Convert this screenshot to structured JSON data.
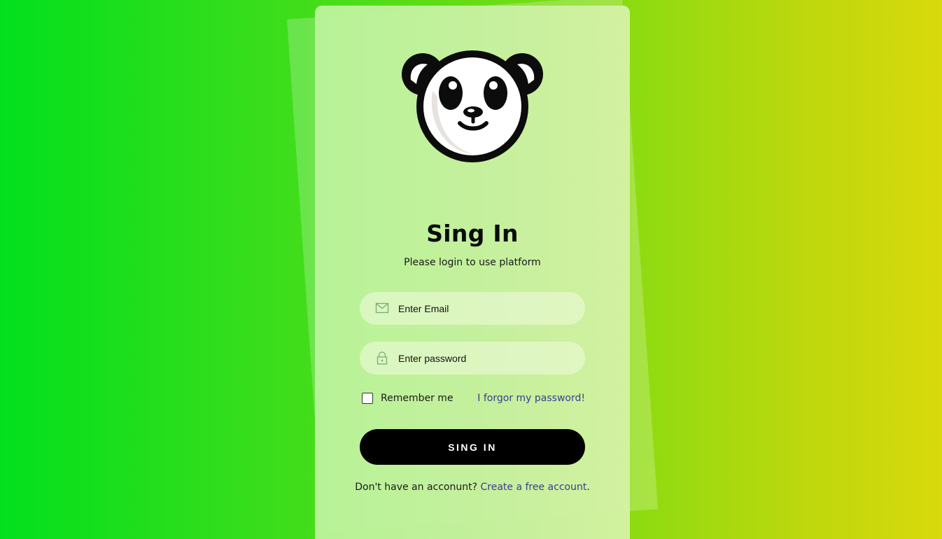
{
  "title": "Sing In",
  "subtitle": "Please login to use platform",
  "email": {
    "placeholder": "Enter Email",
    "icon": "envelope-icon"
  },
  "password": {
    "placeholder": "Enter password",
    "icon": "lock-icon"
  },
  "remember": {
    "label": "Remember me",
    "checked": false
  },
  "forgot_link": "I forgor my password!",
  "signin_button": "SING IN",
  "signup": {
    "prompt": "Don't have an acconunt? ",
    "link": "Create a free account",
    "suffix": "."
  },
  "logo": {
    "icon": "panda-logo"
  },
  "colors": {
    "bg_start": "#02e01d",
    "bg_end": "#d9d90c",
    "button": "#000000",
    "link": "#3b3d8f"
  }
}
